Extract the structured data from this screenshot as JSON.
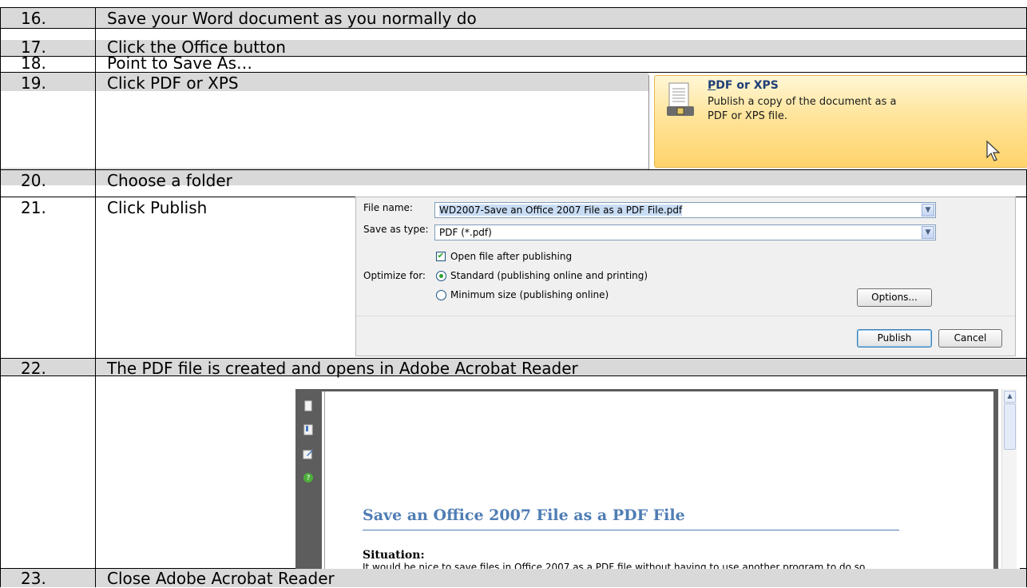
{
  "steps": [
    {
      "number": "16.",
      "text": "Save your Word document as you normally do"
    },
    {
      "number": "17.",
      "text": "Click the Office button"
    },
    {
      "number": "18.",
      "text": "Point to Save As…"
    },
    {
      "number": "19.",
      "text": "Click PDF or XPS"
    },
    {
      "number": "20.",
      "text": "Choose a folder"
    },
    {
      "number": "21.",
      "text": "Click Publish"
    },
    {
      "number": "22.",
      "text": "The PDF file is created and opens in Adobe Acrobat Reader"
    },
    {
      "number": "23.",
      "text": "Close Adobe Acrobat Reader"
    }
  ],
  "pdf_xps_item": {
    "title_underlined": "P",
    "title_rest": "DF or XPS",
    "description": "Publish a copy of the document as a PDF or XPS file."
  },
  "save_dialog": {
    "file_name_label": "File name:",
    "file_name_value": "WD2007-Save an Office 2007 File as a PDF File.pdf",
    "save_as_type_label": "Save as type:",
    "save_as_type_value": "PDF (*.pdf)",
    "open_after_label": "Open file after publishing",
    "open_after_checked": true,
    "optimize_label": "Optimize for:",
    "standard_label": "Standard (publishing online and printing)",
    "minimum_label": "Minimum size (publishing online)",
    "optimize_selected": "standard",
    "options_button": "Options...",
    "publish_button": "Publish",
    "cancel_button": "Cancel"
  },
  "reader": {
    "doc_title": "Save an Office 2007 File as a PDF File",
    "heading": "Situation:",
    "body": "It would be nice to save files in Office 2007 as a PDF file without having to use another program to do so."
  },
  "colors": {
    "row_shade": "#d9d9d9",
    "highlight": "#ffd36b",
    "doc_title": "#4f7db4"
  }
}
